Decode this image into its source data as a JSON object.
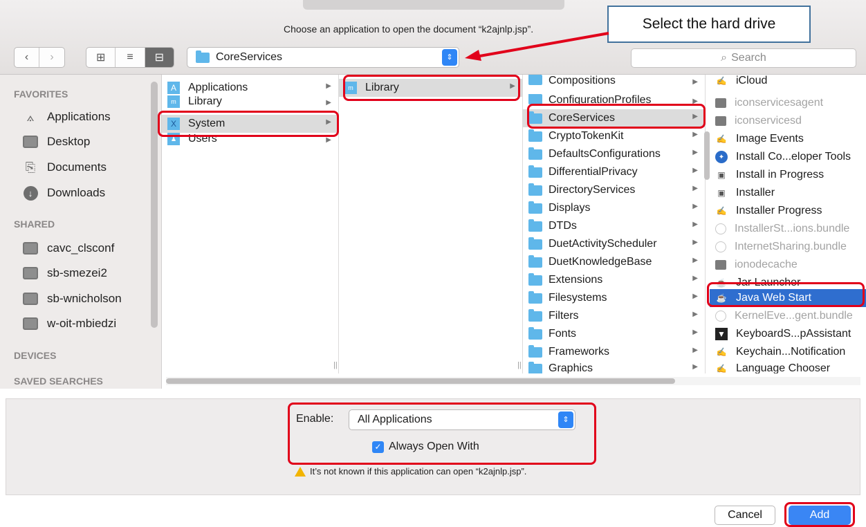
{
  "window": {
    "prompt": "Choose an application to open the document “k2ajnlp.jsp”.",
    "callout": "Select the hard drive"
  },
  "toolbar": {
    "back": "‹",
    "forward": "›",
    "view_icons": "⊞",
    "view_list": "≡",
    "view_columns": "⊟",
    "path": "CoreServices",
    "search_placeholder": "Search"
  },
  "sidebar": {
    "sections": [
      "FAVORITES",
      "SHARED",
      "DEVICES",
      "SAVED SEARCHES"
    ],
    "favorites": [
      "Applications",
      "Desktop",
      "Documents",
      "Downloads"
    ],
    "shared": [
      "cavc_clsconf",
      "sb-smezei2",
      "sb-wnicholson",
      "w-oit-mbiedzi"
    ]
  },
  "columns": {
    "root": [
      "Applications",
      "Library",
      "System",
      "Users"
    ],
    "system": [
      "Library"
    ],
    "library": [
      "Compositions",
      "ConfigurationProfiles",
      "CoreServices",
      "CryptoTokenKit",
      "DefaultsConfigurations",
      "DifferentialPrivacy",
      "DirectoryServices",
      "Displays",
      "DTDs",
      "DuetActivityScheduler",
      "DuetKnowledgeBase",
      "Extensions",
      "Filesystems",
      "Filters",
      "Fonts",
      "Frameworks",
      "Graphics"
    ],
    "coreservices": [
      "iCloud",
      "iconservicesagent",
      "iconservicesd",
      "Image Events",
      "Install Co...eloper Tools",
      "Install in Progress",
      "Installer",
      "Installer Progress",
      "InstallerSt...ions.bundle",
      "InternetSharing.bundle",
      "ionodecache",
      "Jar Launcher",
      "Java Web Start",
      "KernelEve...gent.bundle",
      "KeyboardS...pAssistant",
      "Keychain...Notification",
      "Language Chooser"
    ]
  },
  "options": {
    "enable_label": "Enable:",
    "enable_value": "All Applications",
    "always_open": "Always Open With",
    "warning": "It’s not known if this application can open “k2ajnlp.jsp”."
  },
  "buttons": {
    "cancel": "Cancel",
    "add": "Add"
  },
  "colors": {
    "accent": "#3a86f4",
    "selection": "#2f6ecf",
    "annotation": "#e1001a",
    "callout_border": "#41719c"
  }
}
